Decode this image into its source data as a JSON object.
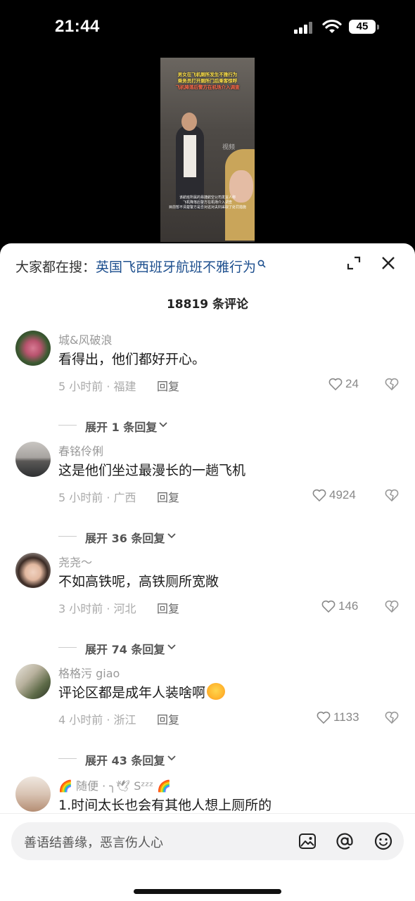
{
  "status_bar": {
    "time": "21:44",
    "battery": "45"
  },
  "video": {
    "caption_lines": [
      "男女在飞机厕所发生不雅行为",
      "乘务员打开厕所门后乘客惊呼",
      "飞机降落后警方在机场介入调查"
    ],
    "subtitle_lines": [
      "该航班所属的易捷航空公司发言人称",
      "飞机降落后警方在机场介入调查",
      "目前暂不清楚警方是否对这对夫妇采取了处罚措施"
    ],
    "watermark": "视频"
  },
  "search_suggest": {
    "prefix": "大家都在搜：",
    "query": "英国飞西班牙航班不雅行为"
  },
  "comment_count": "18819 条评论",
  "comments": [
    {
      "name": "城&风破浪",
      "text": "看得出，他们都好开心。",
      "meta": "5 小时前 · 福建",
      "reply": "回复",
      "likes": "24",
      "expand": "展开 1 条回复"
    },
    {
      "name": "春铭伶俐",
      "text": "这是他们坐过最漫长的一趟飞机",
      "meta": "5 小时前 · 广西",
      "reply": "回复",
      "likes": "4924",
      "expand": "展开 36 条回复"
    },
    {
      "name": "尧尧～",
      "text": "不如高铁呢，高铁厕所宽敞",
      "meta": "3 小时前 · 河北",
      "reply": "回复",
      "likes": "146",
      "expand": "展开 74 条回复"
    },
    {
      "name": "格格污 giao",
      "text": "评论区都是成年人装啥啊",
      "meta": "4 小时前 · 浙江",
      "reply": "回复",
      "likes": "1133",
      "expand": "展开 43 条回复"
    },
    {
      "name": "🌈 随便 · ╮🕊 Sᶻᶻᶻ 🌈",
      "text": "1.时间太长也会有其他人想上厕所的"
    }
  ],
  "input": {
    "placeholder": "善语结善缘，恶言伤人心"
  },
  "icons": [
    "signal-icon",
    "wifi-icon",
    "battery-icon",
    "search-icon",
    "expand-icon",
    "close-icon",
    "heart-icon",
    "dislike-icon",
    "chevron-down-icon",
    "image-icon",
    "at-icon",
    "emoji-icon"
  ]
}
